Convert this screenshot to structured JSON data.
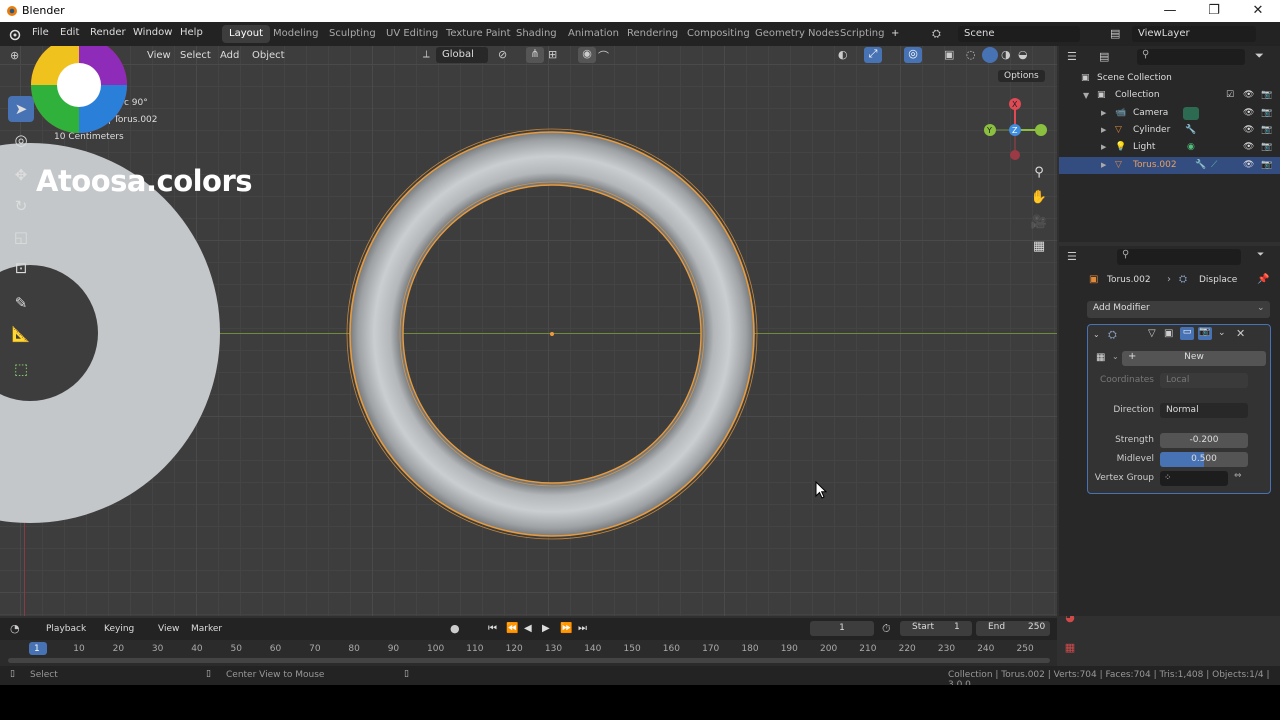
{
  "window": {
    "title": "Blender",
    "minimize": "—",
    "restore": "❐",
    "close": "✕"
  },
  "menu": {
    "file": "File",
    "edit": "Edit",
    "render": "Render",
    "window": "Window",
    "help": "Help"
  },
  "workspaces": [
    "Layout",
    "Modeling",
    "Sculpting",
    "UV Editing",
    "Texture Paint",
    "Shading",
    "Animation",
    "Rendering",
    "Compositing",
    "Geometry Nodes",
    "Scripting"
  ],
  "workspace_add": "+",
  "scene": {
    "name": "Scene",
    "view_layer": "ViewLayer"
  },
  "viewport": {
    "menus": [
      "View",
      "Select",
      "Add",
      "Object"
    ],
    "transform_orientation": "Global",
    "options_label": "Options",
    "overlay_text": {
      "line1": "c 90°",
      "line2": "| Torus.002",
      "line3": "10 Centimeters"
    },
    "watermark": "Atoosa.colors"
  },
  "outliner": {
    "root": "Scene Collection",
    "collection": "Collection",
    "items": [
      {
        "name": "Camera",
        "color": "#e08a3a"
      },
      {
        "name": "Cylinder",
        "color": "#e08a3a"
      },
      {
        "name": "Light",
        "color": "#e08a3a"
      },
      {
        "name": "Torus.002",
        "color": "#e08a3a"
      }
    ]
  },
  "properties": {
    "object": "Torus.002",
    "modifier_name": "Displace",
    "add_modifier": "Add Modifier",
    "new_label": "New",
    "coordinates_label": "Coordinates",
    "coordinates_value": "Local",
    "direction_label": "Direction",
    "direction_value": "Normal",
    "strength_label": "Strength",
    "strength_value": "-0.200",
    "midlevel_label": "Midlevel",
    "midlevel_value": "0.500",
    "midlevel_fraction": 0.5,
    "vertex_group_label": "Vertex Group"
  },
  "timeline": {
    "menus": [
      "Playback",
      "Keying",
      "View",
      "Marker"
    ],
    "current_frame": "1",
    "start_label": "Start",
    "start": "1",
    "end_label": "End",
    "end": "250",
    "ticks": [
      "1",
      "10",
      "20",
      "30",
      "40",
      "50",
      "60",
      "70",
      "80",
      "90",
      "100",
      "110",
      "120",
      "130",
      "140",
      "150",
      "160",
      "170",
      "180",
      "190",
      "200",
      "210",
      "220",
      "230",
      "240",
      "250"
    ]
  },
  "status": {
    "select": "Select",
    "center": "Center View to Mouse",
    "stats": "Collection | Torus.002 | Verts:704 | Faces:704 | Tris:1,408 | Objects:1/4 | 3.0.0"
  },
  "colors": {
    "accent": "#4772b3",
    "selection": "#e89b3d",
    "x_axis": "#e04a55",
    "y_axis": "#8bbf3f",
    "z_axis": "#3f8ee0"
  }
}
